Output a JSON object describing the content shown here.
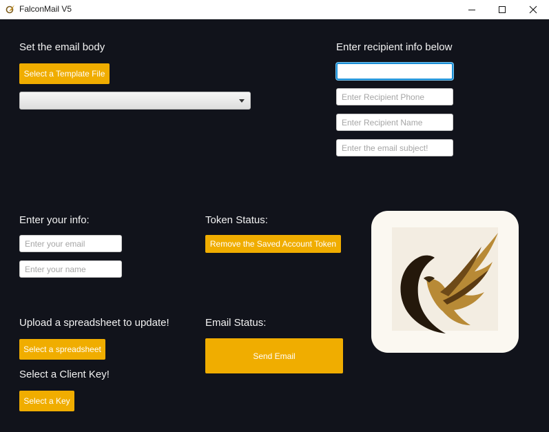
{
  "window": {
    "title": "FalconMail V5"
  },
  "body_section": {
    "heading": "Set the email body",
    "template_button": "Select a Template File"
  },
  "recipient": {
    "heading": "Enter recipient info below",
    "email_value": "",
    "phone_placeholder": "Enter Recipient Phone",
    "name_placeholder": "Enter Recipient Name",
    "subject_placeholder": "Enter the email subject!"
  },
  "user_info": {
    "heading": "Enter your info:",
    "email_placeholder": "Enter your email",
    "name_placeholder": "Enter your name"
  },
  "token": {
    "heading": "Token Status:",
    "remove_button": "Remove the Saved Account Token"
  },
  "spreadsheet": {
    "heading": "Upload a spreadsheet to update!",
    "button": "Select a spreadsheet"
  },
  "client_key": {
    "heading": "Select a Client Key!",
    "button": "Select a Key"
  },
  "email_status": {
    "heading": "Email Status:",
    "send_button": "Send Email"
  },
  "colors": {
    "background": "#11131b",
    "accent": "#f0ad00",
    "focus_border": "#1a8fd6"
  },
  "icons": {
    "app": "falcon-feather-icon",
    "minimize": "minimize-icon",
    "maximize": "maximize-icon",
    "close": "close-icon",
    "logo": "falcon-logo"
  }
}
